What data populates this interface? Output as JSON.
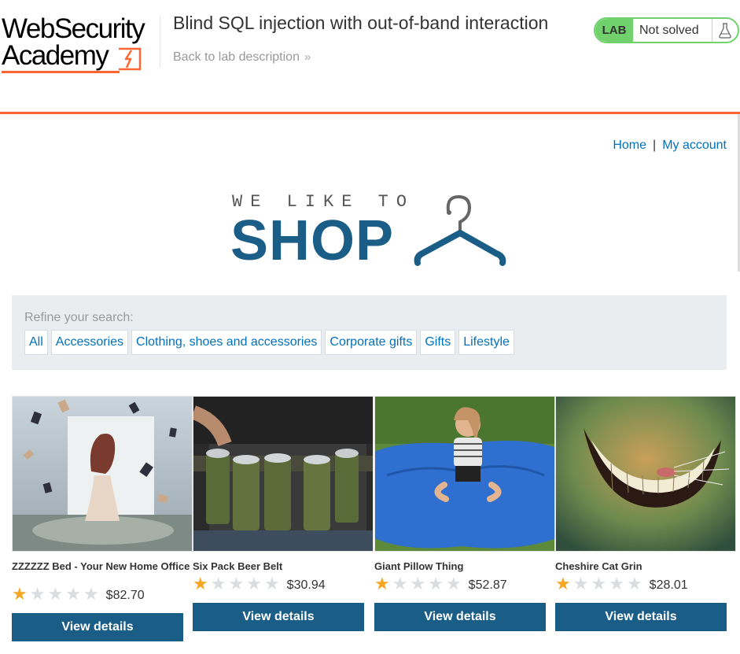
{
  "header": {
    "logo_line1": "WebSecurity",
    "logo_line2": "Academy",
    "lab_title": "Blind SQL injection with out-of-band interaction",
    "back_link": "Back to lab description",
    "lab_badge": "LAB",
    "lab_status": "Not solved"
  },
  "nav": {
    "home": "Home",
    "separator": "|",
    "my_account": "My account"
  },
  "shop_logo": {
    "tagline": "WE LIKE TO",
    "word": "SHOP"
  },
  "filters": {
    "label": "Refine your search:",
    "categories": [
      "All",
      "Accessories",
      "Clothing, shoes and accessories",
      "Corporate gifts",
      "Gifts",
      "Lifestyle"
    ]
  },
  "products": [
    {
      "name": "ZZZZZZ Bed - Your New Home Office",
      "rating": 1,
      "max_rating": 5,
      "price": "$82.70",
      "button": "View details"
    },
    {
      "name": "Six Pack Beer Belt",
      "rating": 1,
      "max_rating": 5,
      "price": "$30.94",
      "button": "View details"
    },
    {
      "name": "Giant Pillow Thing",
      "rating": 1,
      "max_rating": 5,
      "price": "$52.87",
      "button": "View details"
    },
    {
      "name": "Cheshire Cat Grin",
      "rating": 1,
      "max_rating": 5,
      "price": "$28.01",
      "button": "View details"
    }
  ],
  "colors": {
    "accent_orange": "#ff6633",
    "brand_blue": "#1a5d87",
    "link_blue": "#0071bc",
    "lab_green": "#70d16d",
    "star_gold": "#f5a623",
    "filter_bg": "#e9edf0"
  },
  "icons": {
    "flask": "flask-icon",
    "chevrons": "double-chevron-right-icon",
    "hanger": "hanger-icon",
    "star": "star-icon"
  }
}
